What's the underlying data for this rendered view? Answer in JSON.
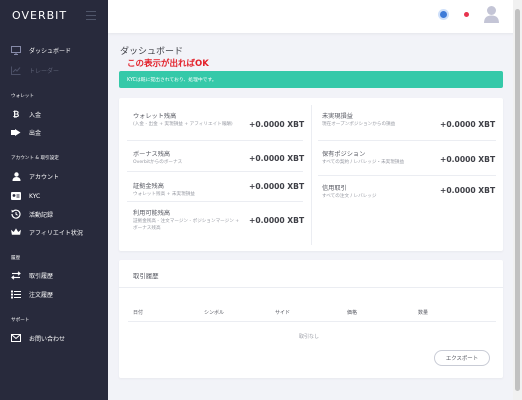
{
  "brand": {
    "logo_text": "OVERBIT"
  },
  "sidebar": {
    "top_items": [
      {
        "label": "ダッシュボード",
        "icon": "monitor-icon",
        "disabled": false
      },
      {
        "label": "トレーダー",
        "icon": "chart-icon",
        "disabled": true
      }
    ],
    "sections": [
      {
        "title": "ウォレット",
        "items": [
          {
            "label": "入金",
            "icon": "bitcoin-icon"
          },
          {
            "label": "出金",
            "icon": "withdraw-icon"
          }
        ]
      },
      {
        "title": "アカウント & 取引設定",
        "items": [
          {
            "label": "アカウント",
            "icon": "user-icon"
          },
          {
            "label": "KYC",
            "icon": "id-card-icon"
          },
          {
            "label": "活動記録",
            "icon": "history-icon"
          },
          {
            "label": "アフィリエイト状況",
            "icon": "crown-icon"
          }
        ]
      },
      {
        "title": "履歴",
        "items": [
          {
            "label": "取引履歴",
            "icon": "exchange-icon"
          },
          {
            "label": "注文履歴",
            "icon": "list-icon"
          }
        ]
      },
      {
        "title": "サポート",
        "items": [
          {
            "label": "お問い合わせ",
            "icon": "mail-icon"
          }
        ]
      }
    ]
  },
  "page": {
    "title": "ダッシュボード",
    "note": "この表示が出ればOK",
    "alert": "KYCは既に提出されており、処理中です。"
  },
  "balances": {
    "left": [
      {
        "title": "ウォレット残高",
        "subtitle": "(入金 - 出金 + 実現損益 + アフィリエイト報酬)",
        "value": "+0.0000 XBT"
      },
      {
        "title": "ボーナス残高",
        "subtitle": "Overbitからのボーナス",
        "value": "+0.0000 XBT"
      },
      {
        "title": "証拠金残高",
        "subtitle": "ウォレット残高 + 未実現損益",
        "value": "+0.0000 XBT"
      },
      {
        "title": "利用可能残高",
        "subtitle": "証拠金残高 - 注文マージン - ポジションマージン + ボーナス残高",
        "value": "+0.0000 XBT"
      }
    ],
    "right": [
      {
        "title": "未実現損益",
        "subtitle": "現在オープンポジションからの損益",
        "value": "+0.0000 XBT"
      },
      {
        "title": "保有ポジション",
        "subtitle": "すべての契約 / レバレッジ・未実現損益",
        "value": "+0.0000 XBT"
      },
      {
        "title": "信用取引",
        "subtitle": "すべての注文 / レバレッジ",
        "value": "+0.0000 XBT"
      }
    ]
  },
  "history": {
    "title": "取引履歴",
    "columns": [
      "日付",
      "シンボル",
      "サイド",
      "価格",
      "数量"
    ],
    "empty_text": "取引なし",
    "export_label": "エクスポート"
  },
  "colors": {
    "sidebar": "#282a3c",
    "alert": "#35c9a9",
    "note": "#e3202a",
    "header_dot_blue": "#3e7bd8",
    "header_dot_red": "#e7334e"
  }
}
